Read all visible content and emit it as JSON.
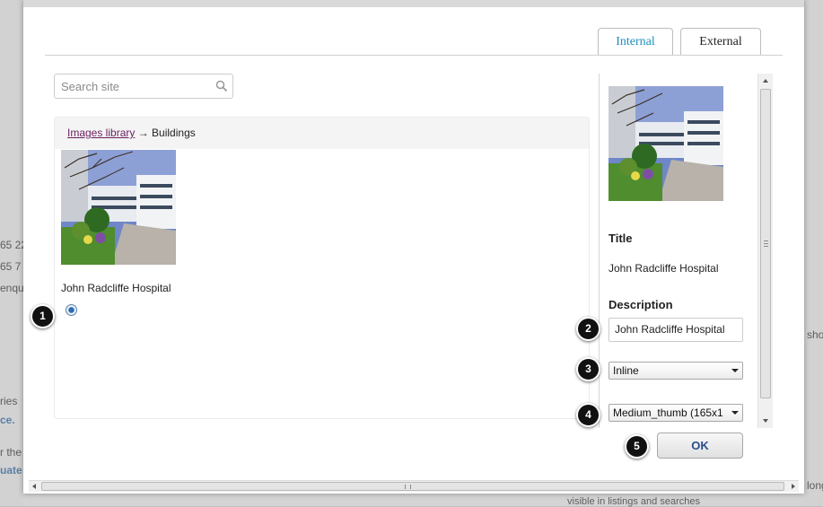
{
  "tabs": [
    {
      "label": "Internal",
      "color": "#1a8fc0",
      "active": true
    },
    {
      "label": "External",
      "color": "#222222",
      "active": false
    }
  ],
  "search": {
    "placeholder": "Search site",
    "icon": "search-icon"
  },
  "breadcrumb": {
    "root": "Images library",
    "separator": "→",
    "current": "Buildings"
  },
  "items": [
    {
      "title": "John Radcliffe Hospital",
      "selected": true
    }
  ],
  "details": {
    "title_label": "Title",
    "title_value": "John Radcliffe Hospital",
    "description_label": "Description",
    "description_value": "John Radcliffe Hospital",
    "alignment_selected": "Inline",
    "size_selected": "Medium_thumb (165x1"
  },
  "ok_label": "OK",
  "badges": [
    "1",
    "2",
    "3",
    "4",
    "5"
  ],
  "background_fragments": [
    "65 22",
    "65 7",
    "enqu",
    "ries",
    "ce.",
    "r the",
    "uate",
    "sho",
    "long",
    "visible in listings and searches"
  ],
  "colors": {
    "accent": "#1a8fc0",
    "link": "#6b1e5e",
    "ok_text": "#2a4d8a"
  }
}
